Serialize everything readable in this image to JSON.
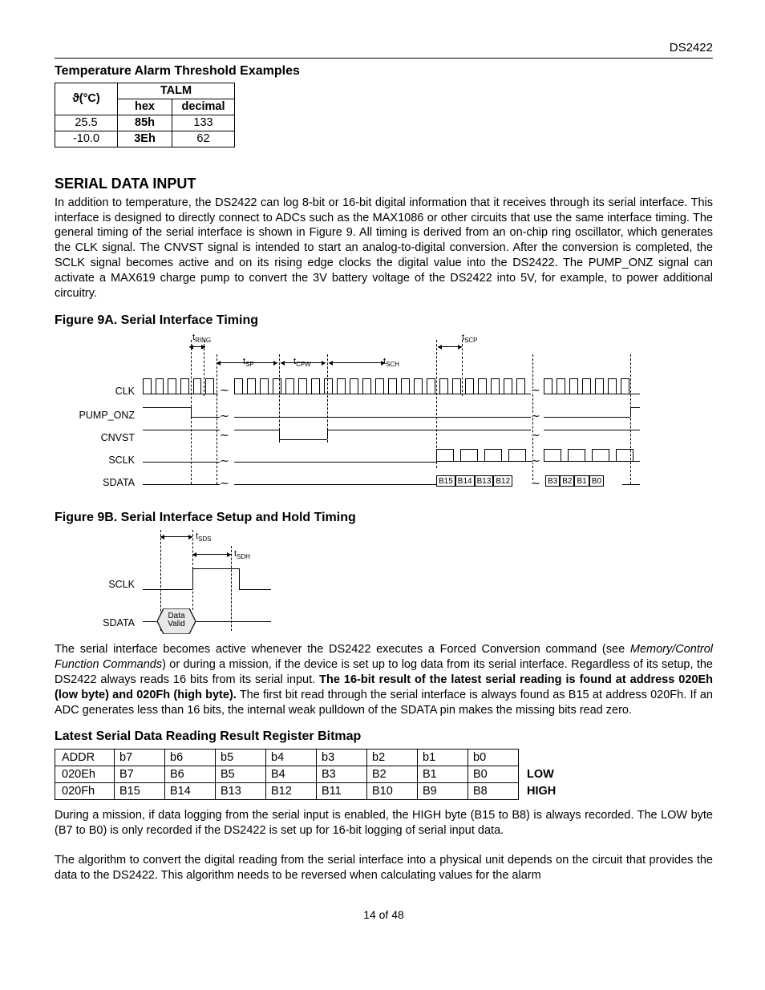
{
  "header": {
    "part_number": "DS2422"
  },
  "sec_talm": {
    "title": "Temperature Alarm Threshold Examples",
    "col_theta": "ϑ(°C)",
    "col_group": "TALM",
    "col_hex": "hex",
    "col_dec": "decimal",
    "rows": [
      {
        "theta": "25.5",
        "hex": "85h",
        "dec": "133"
      },
      {
        "theta": "-10.0",
        "hex": "3Eh",
        "dec": "62"
      }
    ]
  },
  "sec_serial": {
    "title": "SERIAL DATA INPUT",
    "para": "In addition to temperature, the DS2422 can log 8-bit or 16-bit digital information that it receives through its serial interface. This interface is designed to directly connect to ADCs such as the MAX1086 or other circuits that use the same interface timing. The general timing of the serial interface is shown in Figure 9. All timing is derived from an on-chip ring oscillator, which generates the CLK signal. The CNVST signal is intended to start an analog-to-digital conversion. After the conversion is completed, the SCLK signal becomes active and on its rising edge clocks the digital value into the DS2422. The PUMP_ONZ signal can activate a MAX619 charge pump to convert the 3V battery voltage of the DS2422 into 5V, for example, to power additional circuitry."
  },
  "fig9a": {
    "title": "Figure 9A. Serial Interface Timing",
    "labels": {
      "t_ring": "tRING",
      "t_scp": "tSCP",
      "t_sp": "tSP",
      "t_cpw": "tCPW",
      "t_sch": "tSCH"
    },
    "signals": {
      "clk": "CLK",
      "pump": "PUMP_ONZ",
      "cnvst": "CNVST",
      "sclk": "SCLK",
      "sdata": "SDATA"
    },
    "bits_left": [
      "B15",
      "B14",
      "B13",
      "B12"
    ],
    "bits_right": [
      "B3",
      "B2",
      "B1",
      "B0"
    ]
  },
  "fig9b": {
    "title": "Figure 9B. Serial Interface Setup and Hold Timing",
    "labels": {
      "t_sds": "tSDS",
      "t_sdh": "tSDH",
      "data_valid": "Data\nValid"
    },
    "signals": {
      "sclk": "SCLK",
      "sdata": "SDATA"
    }
  },
  "para_after_figs": {
    "p1_pre": "The serial interface becomes active whenever the DS2422 executes a Forced Conversion command (see ",
    "p1_em": "Memory/Control Function Commands",
    "p1_mid": ") or during a mission, if the device is set up to log data from its serial interface. Regardless of its setup, the DS2422 always reads 16 bits from its serial input. ",
    "p1_bold": "The 16-bit result of the latest serial reading is found at address 020Eh (low byte) and 020Fh (high byte).",
    "p1_post": " The first bit read through the serial interface is always found as B15 at address 020Fh. If an ADC generates less than 16 bits, the internal weak pulldown of the SDATA pin makes the missing bits read zero."
  },
  "sec_reg": {
    "title": "Latest Serial Data Reading Result Register Bitmap",
    "header": {
      "addr": "ADDR",
      "b7": "b7",
      "b6": "b6",
      "b5": "b5",
      "b4": "b4",
      "b3": "b3",
      "b2": "b2",
      "b1": "b1",
      "b0": "b0",
      "tag": ""
    },
    "rows": [
      {
        "addr": "020Eh",
        "b7": "B7",
        "b6": "B6",
        "b5": "B5",
        "b4": "B4",
        "b3": "B3",
        "b2": "B2",
        "b1": "B1",
        "b0": "B0",
        "tag": "LOW"
      },
      {
        "addr": "020Fh",
        "b7": "B15",
        "b6": "B14",
        "b5": "B13",
        "b4": "B12",
        "b3": "B11",
        "b2": "B10",
        "b1": "B9",
        "b0": "B8",
        "tag": "HIGH"
      }
    ]
  },
  "trailing": {
    "p1": "During a mission, if data logging from the serial input is enabled, the HIGH byte (B15 to B8) is always recorded. The LOW byte (B7 to B0) is only recorded if the DS2422 is set up for 16-bit logging of serial input data.",
    "p2": "The algorithm to convert the digital reading from the serial interface into a physical unit depends on the circuit that provides the data to the DS2422. This algorithm needs to be reversed when calculating values for the alarm"
  },
  "footer": {
    "page": "14 of 48"
  }
}
